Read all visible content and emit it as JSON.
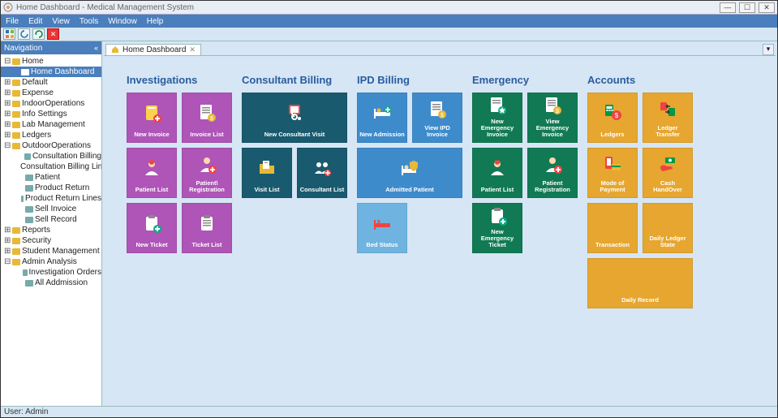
{
  "titlebar": {
    "text": "Home Dashboard - Medical Management System"
  },
  "menu": {
    "file": "File",
    "edit": "Edit",
    "view": "View",
    "tools": "Tools",
    "window": "Window",
    "help": "Help"
  },
  "nav": {
    "title": "Navigation",
    "root": "Home",
    "active": "Home Dashboard",
    "items": [
      {
        "label": "Default",
        "kind": "folder"
      },
      {
        "label": "Expense",
        "kind": "folder"
      },
      {
        "label": "IndoorOperations",
        "kind": "folder"
      },
      {
        "label": "Info Settings",
        "kind": "folder"
      },
      {
        "label": "Lab Management",
        "kind": "folder"
      },
      {
        "label": "Ledgers",
        "kind": "folder"
      },
      {
        "label": "OutdoorOperations",
        "kind": "folder-expanded"
      },
      {
        "label": "Consultation Billing",
        "kind": "leaf",
        "child": true
      },
      {
        "label": "Consultation Billing Lines",
        "kind": "leaf",
        "child": true
      },
      {
        "label": "Patient",
        "kind": "leaf",
        "child": true
      },
      {
        "label": "Product Return",
        "kind": "leaf",
        "child": true
      },
      {
        "label": "Product Return Lines",
        "kind": "leaf",
        "child": true
      },
      {
        "label": "Sell Invoice",
        "kind": "leaf",
        "child": true
      },
      {
        "label": "Sell Record",
        "kind": "leaf",
        "child": true
      },
      {
        "label": "Reports",
        "kind": "folder"
      },
      {
        "label": "Security",
        "kind": "folder"
      },
      {
        "label": "Student Management",
        "kind": "folder"
      },
      {
        "label": "Admin Analysis",
        "kind": "folder-expanded"
      },
      {
        "label": "Investigation Orders",
        "kind": "leaf",
        "child": true
      },
      {
        "label": "All Addmission",
        "kind": "leaf",
        "child": true
      }
    ]
  },
  "tab": {
    "label": "Home Dashboard"
  },
  "sections": [
    {
      "title": "Investigations",
      "tiles": [
        {
          "label": "New Invoice",
          "icon": "doc-plus",
          "color": "c-purple"
        },
        {
          "label": "Invoice List",
          "icon": "doc-money",
          "color": "c-purple"
        },
        {
          "label": "Patient List",
          "icon": "person-heart",
          "color": "c-purple"
        },
        {
          "label": "Patient\\ Registration",
          "icon": "person-plus",
          "color": "c-purple"
        },
        {
          "label": "New Ticket",
          "icon": "clipboard-plus",
          "color": "c-purple"
        },
        {
          "label": "Ticket List",
          "icon": "clipboard-list",
          "color": "c-purple"
        }
      ]
    },
    {
      "title": "Consultant Billing",
      "tiles": [
        {
          "label": "New Consultant Visit",
          "icon": "stethoscope",
          "color": "c-teal",
          "span2": true
        },
        {
          "label": "Visit List",
          "icon": "folder-files",
          "color": "c-teal"
        },
        {
          "label": "Consultant List",
          "icon": "people",
          "color": "c-teal"
        }
      ]
    },
    {
      "title": "IPD Billing",
      "tiles": [
        {
          "label": "New Admission",
          "icon": "bed-plus",
          "color": "c-blue"
        },
        {
          "label": "View IPD Invoice",
          "icon": "doc-money",
          "color": "c-blue"
        },
        {
          "label": "Admitted Patient",
          "icon": "bed-shield",
          "color": "c-blue",
          "span2": true
        },
        {
          "label": "Bed Status",
          "icon": "bed",
          "color": "c-sky",
          "span1row": true
        }
      ]
    },
    {
      "title": "Emergency",
      "tiles": [
        {
          "label": "New Emergency Invoice",
          "icon": "doc-star",
          "color": "c-green"
        },
        {
          "label": "View Emergency Invoice",
          "icon": "doc-money",
          "color": "c-green"
        },
        {
          "label": "Patient List",
          "icon": "person-heart",
          "color": "c-green"
        },
        {
          "label": "Patient Registration",
          "icon": "person-plus",
          "color": "c-green"
        },
        {
          "label": "New Emergency Ticket",
          "icon": "clipboard-plus",
          "color": "c-green",
          "span1row": true
        }
      ]
    },
    {
      "title": "Accounts",
      "tiles": [
        {
          "label": "Ledgers",
          "icon": "calc-money",
          "color": "c-amber"
        },
        {
          "label": "Ledger Transfer",
          "icon": "transfer",
          "color": "c-amber"
        },
        {
          "label": "Mode of Payment",
          "icon": "card-phone",
          "color": "c-amber"
        },
        {
          "label": "Cash HandOver",
          "icon": "hand-cash",
          "color": "c-amber"
        },
        {
          "label": "Transaction",
          "icon": "blank",
          "color": "c-amber"
        },
        {
          "label": "Daily Ledger State",
          "icon": "blank",
          "color": "c-amber"
        },
        {
          "label": "Daily Record",
          "icon": "blank",
          "color": "c-amber",
          "span2": true
        }
      ]
    }
  ],
  "status": {
    "user": "User: Admin"
  },
  "icons": {
    "gear": "gear",
    "refresh": "refresh",
    "close": "close"
  }
}
